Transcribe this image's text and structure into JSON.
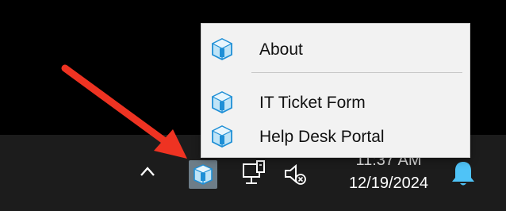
{
  "context_menu": {
    "items": [
      {
        "label": "About",
        "icon": "app-box-icon"
      },
      {
        "label": "IT Ticket Form",
        "icon": "app-box-icon"
      },
      {
        "label": "Help Desk Portal",
        "icon": "app-box-icon"
      }
    ]
  },
  "taskbar": {
    "clock_time": "11:37 AM",
    "clock_date": "12/19/2024",
    "tray_icons": [
      "chevron-up-icon",
      "app-box-icon",
      "network-icon",
      "volume-muted-icon",
      "notification-bell-icon"
    ]
  },
  "colors": {
    "menu_background": "#f2f2f2",
    "taskbar": "#1c1c1c",
    "arrow": "#ee3322",
    "bell": "#4fc3f7",
    "app_icon_blue": "#1e8fd6"
  }
}
